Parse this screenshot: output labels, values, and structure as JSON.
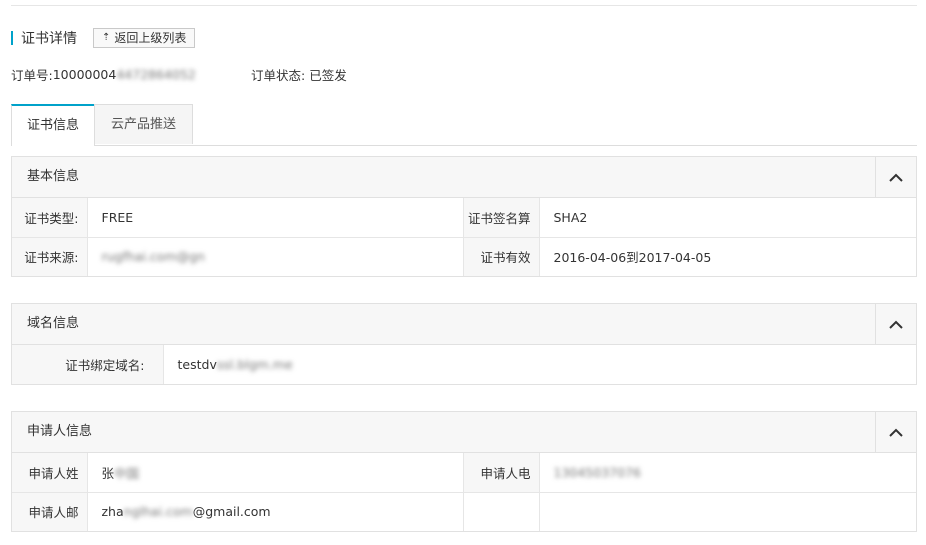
{
  "header": {
    "title": "证书详情",
    "back_label": "返回上级列表",
    "back_icon": "upload-arrow-icon"
  },
  "order": {
    "number_label": "订单号:",
    "number_prefix": "10000004",
    "number_blurred": "4472864052",
    "status_label": "订单状态:",
    "status_value": "已签发"
  },
  "tabs": [
    {
      "label": "证书信息",
      "active": true
    },
    {
      "label": "云产品推送",
      "active": false
    }
  ],
  "basic_info": {
    "title": "基本信息",
    "rows": [
      {
        "label1": "证书类型:",
        "value1": "FREE",
        "label2": "证书签名算",
        "value2": "SHA2"
      },
      {
        "label1": "证书来源:",
        "value1": "rugfhai.com@gn",
        "label2": "证书有效",
        "value2": "2016-04-06到2017-04-05"
      }
    ]
  },
  "domain_info": {
    "title": "域名信息",
    "label": "证书绑定域名:",
    "value_prefix": "testdv",
    "value_blurred": "ssl.blgm.me"
  },
  "applicant_info": {
    "title": "申请人信息",
    "rows": [
      {
        "label1": "申请人姓",
        "value1_prefix": "张",
        "value1_blurred": "中国",
        "label2": "申请人电",
        "value2_blurred": "13045037076"
      },
      {
        "label1": "申请人邮",
        "value1_prefix": "zha",
        "value1_blurred": "nglhai.com",
        "value1_suffix": "@gmail.com",
        "label2": "",
        "value2": ""
      }
    ]
  }
}
